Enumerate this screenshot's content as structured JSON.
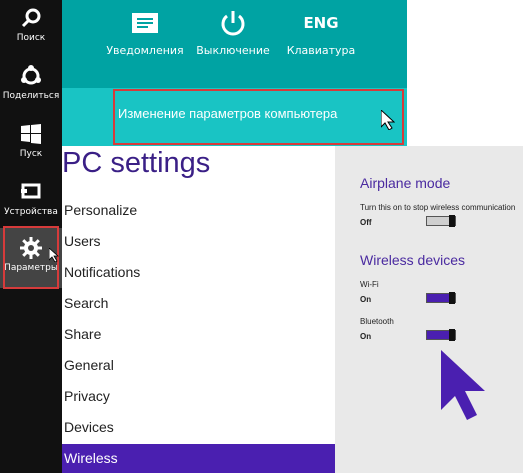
{
  "charms": [
    {
      "label": "Поиск",
      "icon": "search-icon"
    },
    {
      "label": "Поделиться",
      "icon": "share-icon"
    },
    {
      "label": "Пуск",
      "icon": "windows-logo-icon"
    },
    {
      "label": "Устройства",
      "icon": "devices-icon"
    },
    {
      "label": "Параметры",
      "icon": "gear-icon"
    }
  ],
  "quick_actions": [
    {
      "label": "Уведомления",
      "icon": "notifications-icon"
    },
    {
      "label": "Выключение",
      "icon": "power-icon"
    },
    {
      "label": "Клавиатура",
      "icon_text": "ENG"
    }
  ],
  "settings_link": "Изменение параметров компьютера",
  "pc_settings": {
    "title": "PC settings",
    "nav": [
      "Personalize",
      "Users",
      "Notifications",
      "Search",
      "Share",
      "General",
      "Privacy",
      "Devices",
      "Wireless"
    ],
    "selected": "Wireless"
  },
  "airplane": {
    "title": "Airplane mode",
    "desc": "Turn this on to stop wireless communication",
    "state": "Off",
    "level": 0
  },
  "wireless_devices": {
    "title": "Wireless devices",
    "wifi": {
      "label": "Wi-Fi",
      "state": "On",
      "level": 1
    },
    "bluetooth": {
      "label": "Bluetooth",
      "state": "On",
      "level": 1
    }
  },
  "colors": {
    "accent": "#4a1fb0",
    "teal": "#00a3a3",
    "highlight_border": "#d63b3b"
  }
}
